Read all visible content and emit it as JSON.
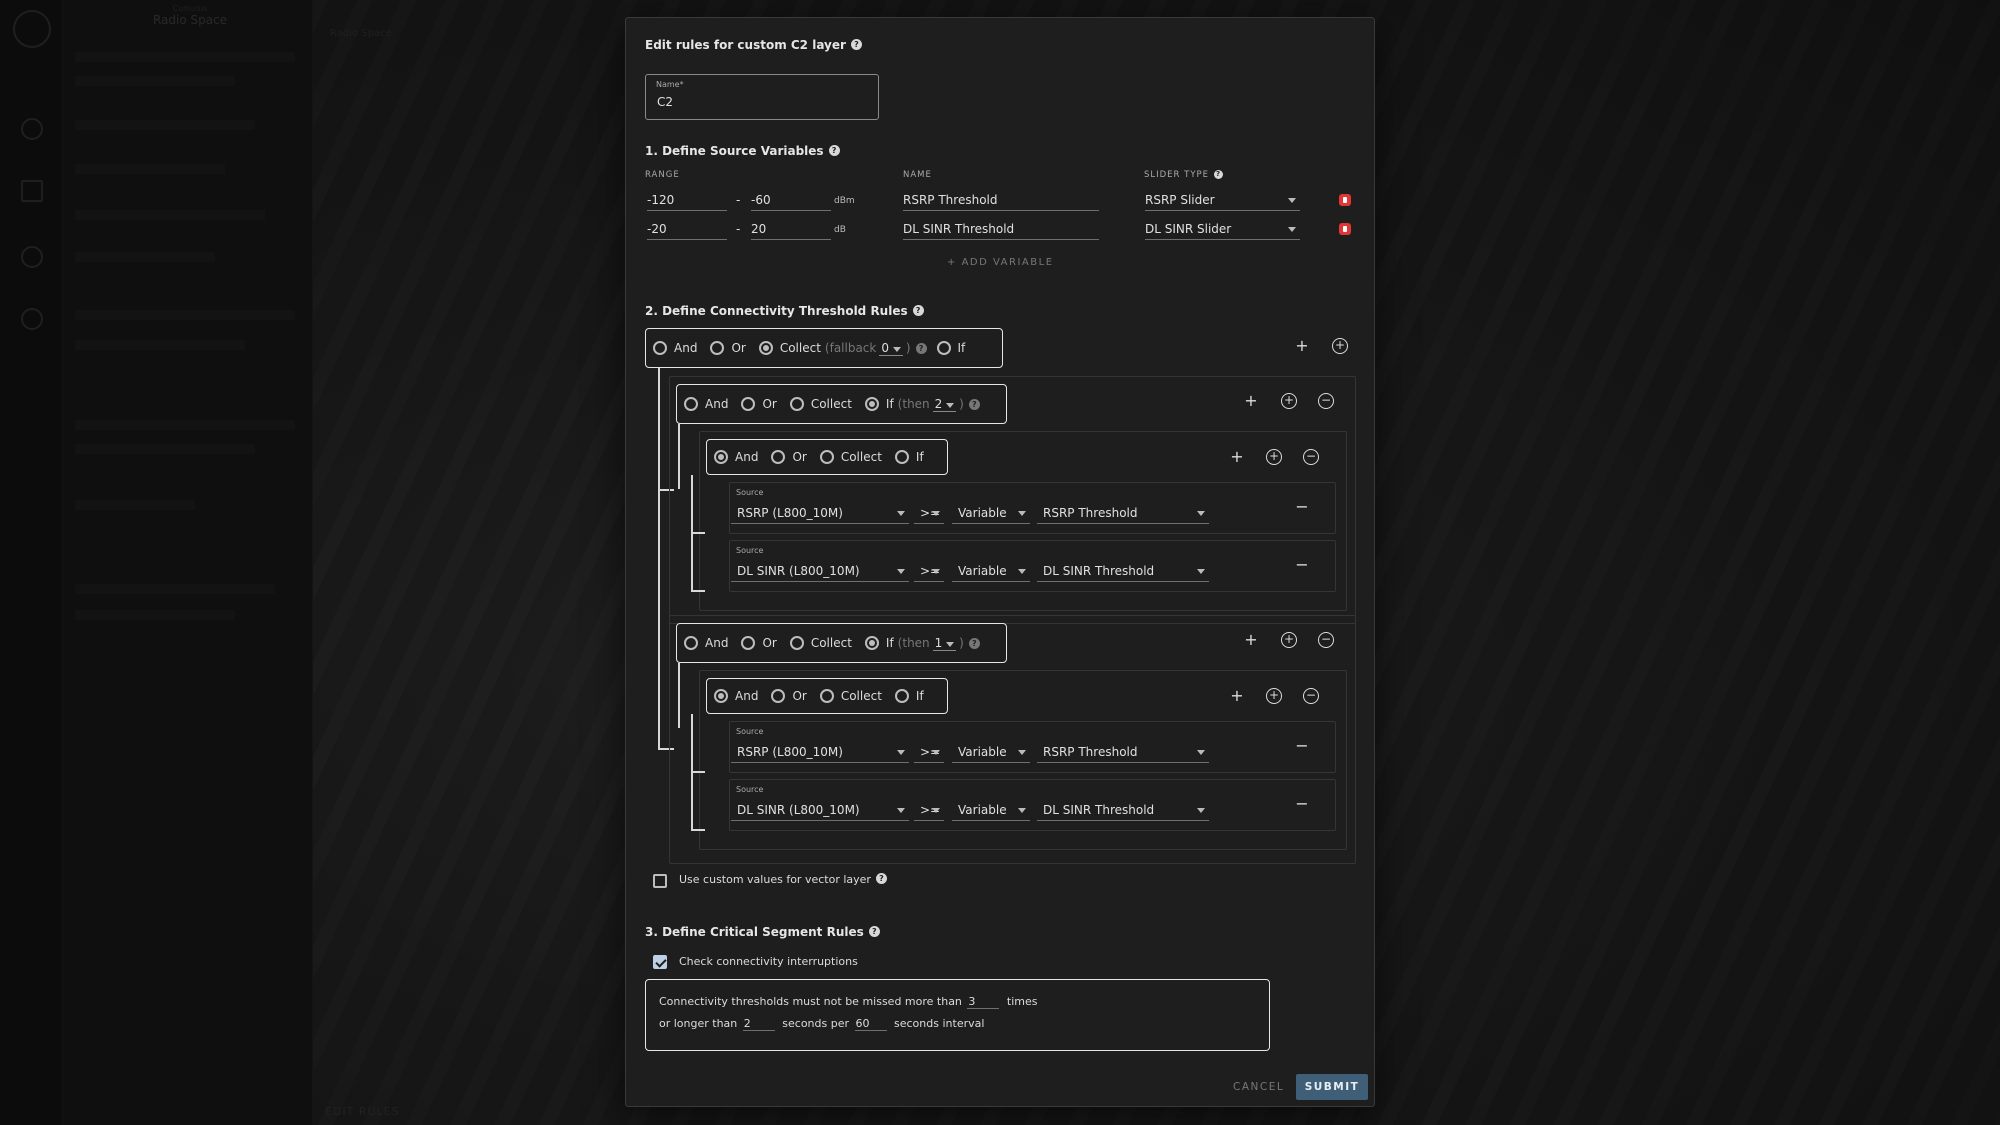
{
  "background": {
    "app_title": "Radio Space",
    "app_subtitle": "Cumulus",
    "topbar_text": "Radio Space",
    "edit_rules_label": "EDIT RULES"
  },
  "modal": {
    "title": "Edit rules for custom C2 layer",
    "name_field": {
      "label": "Name*",
      "value": "C2"
    },
    "section1": {
      "title": "1. Define Source Variables",
      "col_range": "RANGE",
      "col_name": "NAME",
      "col_slider_type": "SLIDER TYPE",
      "variables": [
        {
          "min": "-120",
          "max": "-60",
          "unit": "dBm",
          "name": "RSRP Threshold",
          "slider": "RSRP Slider"
        },
        {
          "min": "-20",
          "max": "20",
          "unit": "dB",
          "name": "DL SINR Threshold",
          "slider": "DL SINR Slider"
        }
      ],
      "add_variable": "ADD VARIABLE"
    },
    "section2": {
      "title": "2. Define Connectivity Threshold Rules",
      "options": {
        "and": "And",
        "or": "Or",
        "collect": "Collect",
        "if": "If"
      },
      "root": {
        "selected": "collect",
        "param_label": "fallback",
        "param_value": "0"
      },
      "groups": [
        {
          "selected": "if",
          "param_label": "then",
          "param_value": "2",
          "sub": {
            "selected": "and",
            "conditions": [
              {
                "label": "Source",
                "source": "RSRP (L800_10M)",
                "op": ">=",
                "kind": "Variable",
                "var": "RSRP Threshold"
              },
              {
                "label": "Source",
                "source": "DL SINR (L800_10M)",
                "op": ">=",
                "kind": "Variable",
                "var": "DL SINR Threshold"
              }
            ]
          }
        },
        {
          "selected": "if",
          "param_label": "then",
          "param_value": "1",
          "sub": {
            "selected": "and",
            "conditions": [
              {
                "label": "Source",
                "source": "RSRP (L800_10M)",
                "op": ">=",
                "kind": "Variable",
                "var": "RSRP Threshold"
              },
              {
                "label": "Source",
                "source": "DL SINR (L800_10M)",
                "op": ">=",
                "kind": "Variable",
                "var": "DL SINR Threshold"
              }
            ]
          }
        }
      ],
      "custom_vector_label": "Use custom values for vector layer",
      "custom_vector_checked": false
    },
    "section3": {
      "title": "3. Define Critical Segment Rules",
      "check_label": "Check connectivity interruptions",
      "check_checked": true,
      "line1_prefix": "Connectivity thresholds must not be missed more than",
      "times_value": "3",
      "line1_suffix": "times",
      "line2_prefix": "or longer than",
      "seconds_value": "2",
      "line2_mid": "seconds per",
      "interval_value": "60",
      "line2_suffix": "seconds interval"
    },
    "actions": {
      "cancel": "CANCEL",
      "submit": "SUBMIT"
    }
  },
  "colors": {
    "accent": "#3f5f78",
    "danger": "#e03636",
    "modal_bg": "#1e1e1e"
  }
}
